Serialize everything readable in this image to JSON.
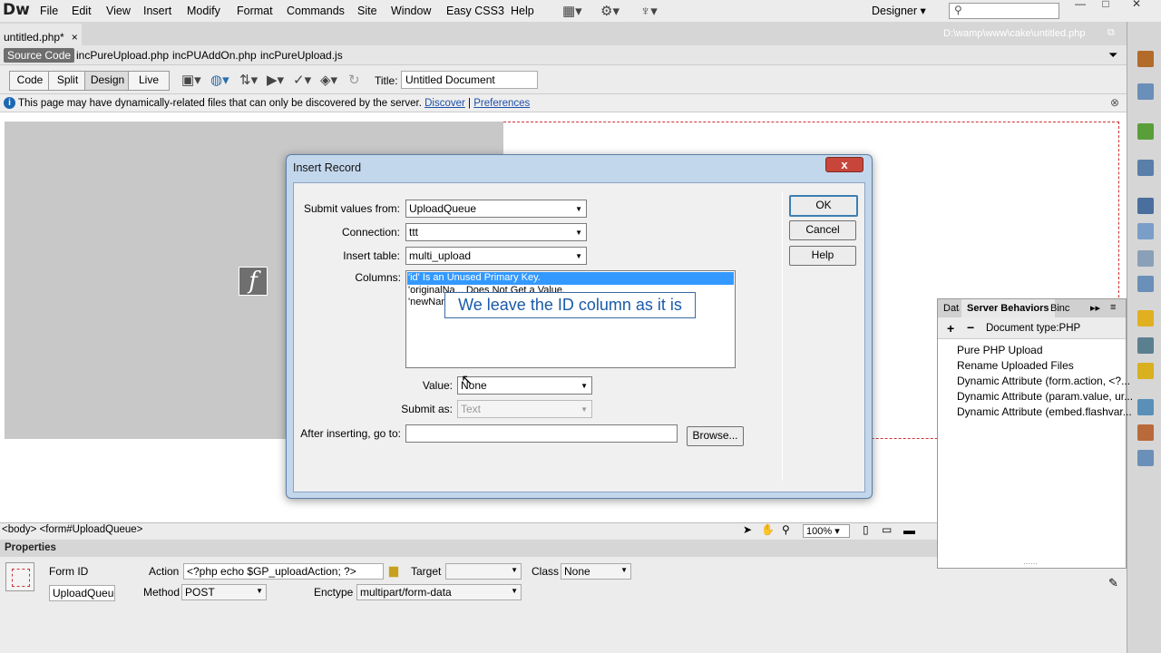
{
  "app": {
    "logo": "Dw"
  },
  "menu": [
    "File",
    "Edit",
    "View",
    "Insert",
    "Modify",
    "Format",
    "Commands",
    "Site",
    "Window",
    "Easy CSS3",
    "Help"
  ],
  "workspace": "Designer",
  "search": {
    "placeholder": ""
  },
  "doc_tab": {
    "name": "untitled.php*",
    "close": "×",
    "path": "D:\\wamp\\www\\cake\\untitled.php"
  },
  "related_files": [
    "Source Code",
    "incPureUpload.php",
    "incPUAddOn.php",
    "incPureUpload.js"
  ],
  "views": [
    "Code",
    "Split",
    "Design",
    "Live"
  ],
  "title_field": {
    "label": "Title:",
    "value": "Untitled Document"
  },
  "info_bar": {
    "text": "This page may have dynamically-related files that can only be discovered by the server.",
    "discover": "Discover",
    "separator": "|",
    "preferences": "Preferences"
  },
  "status_bar": {
    "tags": "<body> <form#UploadQueue>",
    "zoom": "100%"
  },
  "properties": {
    "title": "Properties",
    "form_id_label": "Form ID",
    "form_id": "UploadQueue",
    "action_label": "Action",
    "action": "<?php echo $GP_uploadAction; ?>",
    "method_label": "Method",
    "method": "POST",
    "target_label": "Target",
    "target": "",
    "class_label": "Class",
    "class": "None",
    "enctype_label": "Enctype",
    "enctype": "multipart/form-data"
  },
  "server_panel": {
    "tabs": [
      "Data",
      "Server Behaviors",
      "Binc"
    ],
    "add": "+",
    "remove": "−",
    "doc_type": "Document type:PHP",
    "items": [
      "Pure PHP Upload",
      "Rename Uploaded Files",
      "Dynamic Attribute (form.action, <?...",
      "Dynamic Attribute (param.value, ur...",
      "Dynamic Attribute (embed.flashvar..."
    ]
  },
  "dialog": {
    "title": "Insert Record",
    "close": "x",
    "submit_label": "Submit values from:",
    "submit_value": "UploadQueue",
    "connection_label": "Connection:",
    "connection_value": "ttt",
    "table_label": "Insert table:",
    "table_value": "multi_upload",
    "columns_label": "Columns:",
    "columns": [
      "'id' Is an Unused Primary Key.",
      "'originalNa... Does Not Get a Value.",
      "'newNam..."
    ],
    "value_label": "Value:",
    "value_value": "None",
    "submit_as_label": "Submit as:",
    "submit_as_value": "Text",
    "after_label": "After inserting, go to:",
    "after_value": "",
    "browse": "Browse...",
    "ok": "OK",
    "cancel": "Cancel",
    "help": "Help"
  },
  "callout": "We leave the ID column as it is",
  "colors": {
    "selection": "#3399ff",
    "dialog_frame": "#c3d7ec",
    "close_red": "#c7453a",
    "link": "#1d4fa8"
  }
}
